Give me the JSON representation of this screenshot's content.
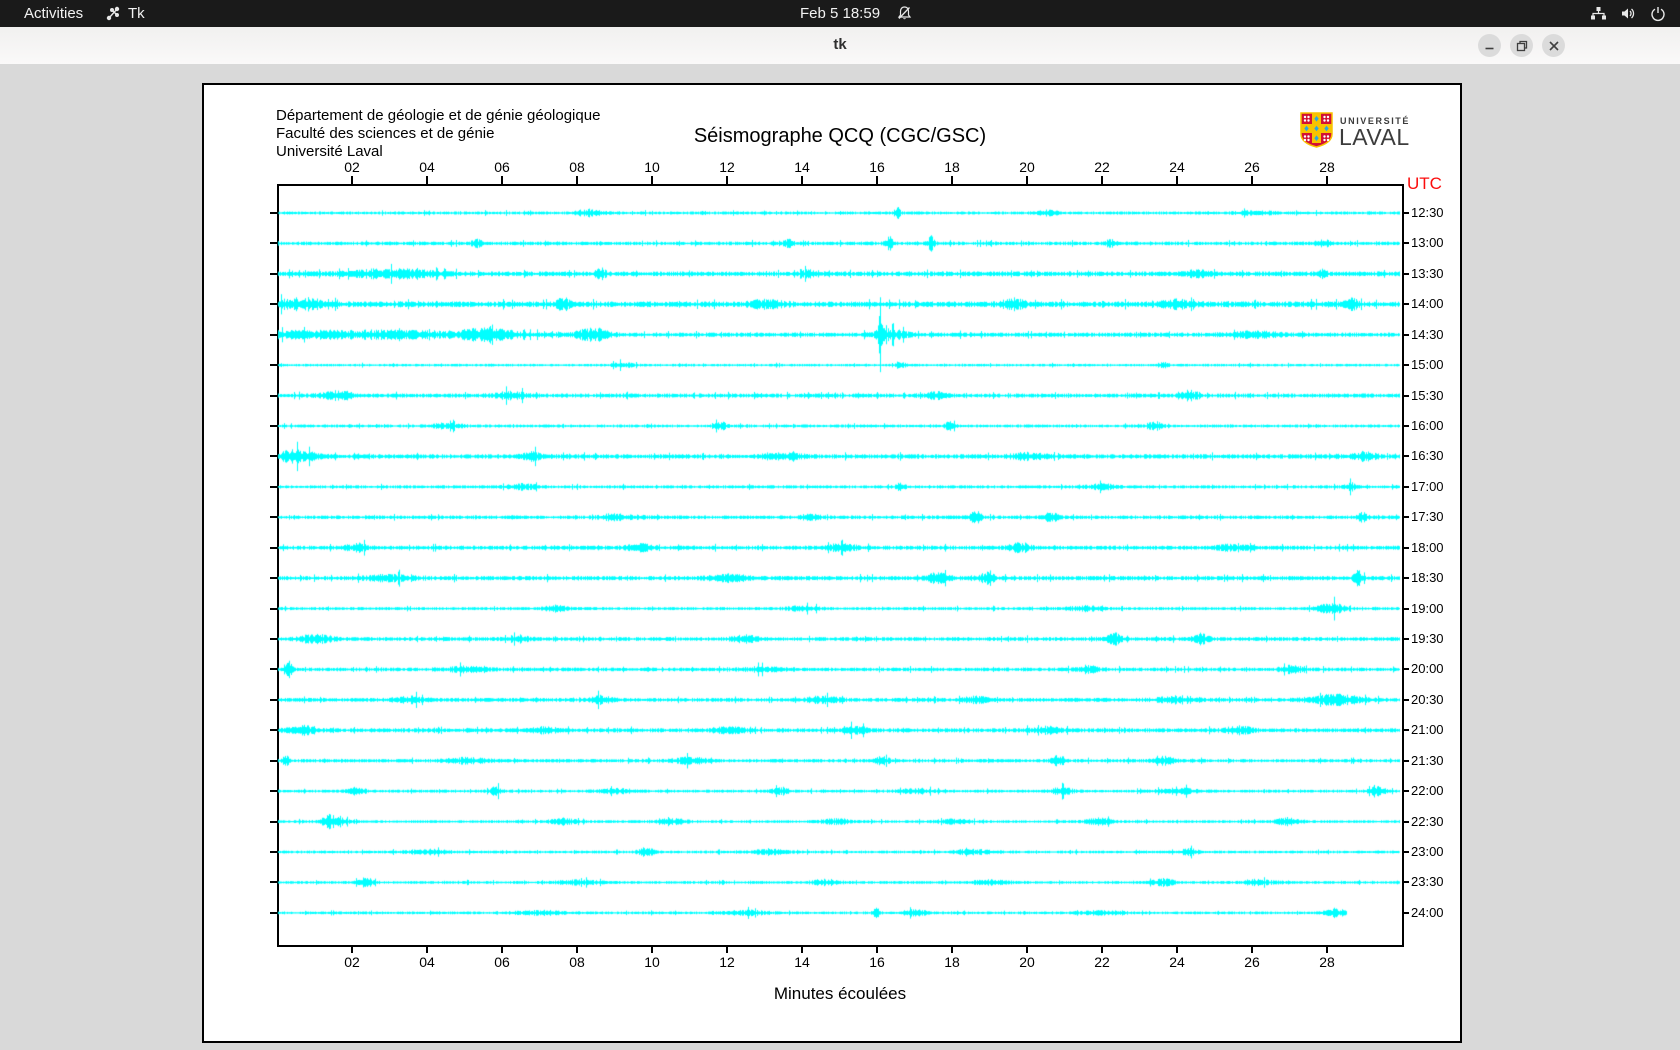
{
  "topbar": {
    "activities_label": "Activities",
    "app_name": "Tk",
    "clock": "Feb 5 18:59",
    "icons": {
      "app": "tk-icon",
      "notifications": "bell-muted-icon",
      "network": "network-icon",
      "volume": "volume-icon",
      "power": "power-icon"
    }
  },
  "titlebar": {
    "title": "tk",
    "icons": {
      "minimize": "minimize-icon",
      "maximize": "restore-icon",
      "close": "close-icon"
    }
  },
  "seismograph": {
    "header_lines": [
      "Département de géologie et de génie géologique",
      "Faculté des sciences et de génie",
      "Université Laval"
    ],
    "title": "Séismographe QCQ (CGC/GSC)",
    "logo": {
      "line1": "UNIVERSITÉ",
      "line2": "LAVAL",
      "crest_red": "#d21034",
      "crest_gold": "#f8c300",
      "crest_blue": "#2aa8e0"
    },
    "utc_label": "UTC",
    "xlabel": "Minutes écoulées",
    "colors": {
      "trace": "#00ffff",
      "utc_label": "#fb0d0d",
      "axis": "#000000",
      "background": "#ffffff"
    },
    "chart_data": {
      "type": "seismogram-helicorder",
      "x_unit": "minutes",
      "x_range": [
        0,
        30
      ],
      "x_tick_labels": [
        "02",
        "04",
        "06",
        "08",
        "10",
        "12",
        "14",
        "16",
        "18",
        "20",
        "22",
        "24",
        "26",
        "28"
      ],
      "trace_color": "#00ffff",
      "row_spacing_px": 30.43,
      "traces": [
        {
          "label": "12:30",
          "base": 1.4,
          "events": [
            [
              8.3,
              3,
              0.25
            ],
            [
              16.5,
              5,
              0.06
            ],
            [
              20.5,
              2,
              0.2
            ],
            [
              26,
              1.5,
              0.4
            ]
          ]
        },
        {
          "label": "13:00",
          "base": 1.7,
          "events": [
            [
              5.3,
              3,
              0.1
            ],
            [
              13.6,
              4,
              0.08
            ],
            [
              16.3,
              5,
              0.07
            ],
            [
              17.4,
              6,
              0.06
            ],
            [
              22.2,
              3,
              0.1
            ],
            [
              27.9,
              3,
              0.1
            ]
          ]
        },
        {
          "label": "13:30",
          "base": 2.2,
          "events": [
            [
              3,
              3.5,
              0.8
            ],
            [
              8.6,
              4,
              0.1
            ],
            [
              14.2,
              3,
              0.15
            ],
            [
              24.5,
              3,
              0.2
            ],
            [
              27.8,
              4,
              0.1
            ]
          ]
        },
        {
          "label": "14:00",
          "base": 2.6,
          "events": [
            [
              0.6,
              4,
              0.5
            ],
            [
              7.6,
              5,
              0.12
            ],
            [
              13,
              3,
              0.3
            ],
            [
              19.6,
              4,
              0.2
            ],
            [
              24,
              3,
              0.3
            ],
            [
              28.6,
              5,
              0.12
            ]
          ]
        },
        {
          "label": "14:30",
          "base": 2.0,
          "events": [
            [
              2,
              3,
              2.5
            ],
            [
              5.6,
              4,
              0.5
            ],
            [
              8.4,
              5,
              0.3
            ],
            [
              16.05,
              16,
              0.05
            ],
            [
              16.3,
              4,
              0.3
            ],
            [
              26,
              2,
              0.5
            ]
          ]
        },
        {
          "label": "15:00",
          "base": 1.2,
          "events": [
            [
              9.2,
              2,
              0.2
            ],
            [
              16.6,
              3,
              0.08
            ],
            [
              23.6,
              2.5,
              0.1
            ]
          ]
        },
        {
          "label": "15:30",
          "base": 1.9,
          "events": [
            [
              1.6,
              3.5,
              0.3
            ],
            [
              6.2,
              3,
              0.3
            ],
            [
              17.5,
              2.5,
              0.2
            ],
            [
              24.3,
              4,
              0.15
            ]
          ]
        },
        {
          "label": "16:00",
          "base": 1.4,
          "events": [
            [
              4.5,
              2,
              0.3
            ],
            [
              11.8,
              3,
              0.12
            ],
            [
              17.9,
              3,
              0.1
            ],
            [
              23.4,
              3.5,
              0.12
            ]
          ]
        },
        {
          "label": "16:30",
          "base": 2.1,
          "events": [
            [
              0.5,
              5,
              0.35
            ],
            [
              6.8,
              3.5,
              0.2
            ],
            [
              13.5,
              2.5,
              0.3
            ],
            [
              20,
              2.5,
              0.3
            ],
            [
              29,
              3.5,
              0.2
            ]
          ]
        },
        {
          "label": "17:00",
          "base": 1.5,
          "events": [
            [
              6.5,
              2,
              0.3
            ],
            [
              16.6,
              3.5,
              0.08
            ],
            [
              22,
              2,
              0.3
            ],
            [
              28.6,
              3,
              0.1
            ]
          ]
        },
        {
          "label": "17:30",
          "base": 1.7,
          "events": [
            [
              9,
              2.5,
              0.3
            ],
            [
              14.2,
              3,
              0.15
            ],
            [
              18.6,
              5,
              0.1
            ],
            [
              20.6,
              4,
              0.12
            ],
            [
              28.9,
              3.5,
              0.1
            ]
          ]
        },
        {
          "label": "18:00",
          "base": 1.9,
          "events": [
            [
              2.1,
              3,
              0.2
            ],
            [
              9.6,
              3,
              0.25
            ],
            [
              15,
              2.5,
              0.3
            ],
            [
              19.8,
              3.5,
              0.2
            ],
            [
              25.5,
              2.5,
              0.3
            ]
          ]
        },
        {
          "label": "18:30",
          "base": 2.0,
          "events": [
            [
              3,
              2.5,
              0.4
            ],
            [
              12,
              2.5,
              0.4
            ],
            [
              17.6,
              4,
              0.2
            ],
            [
              18.9,
              4,
              0.15
            ],
            [
              28.8,
              7,
              0.08
            ]
          ]
        },
        {
          "label": "19:00",
          "base": 1.4,
          "events": [
            [
              7.4,
              2.5,
              0.2
            ],
            [
              14,
              2,
              0.3
            ],
            [
              21.5,
              2,
              0.3
            ],
            [
              28.1,
              4.5,
              0.25
            ]
          ]
        },
        {
          "label": "19:30",
          "base": 1.8,
          "events": [
            [
              1,
              3.5,
              0.3
            ],
            [
              6.4,
              3,
              0.2
            ],
            [
              12.5,
              2.5,
              0.3
            ],
            [
              22.3,
              5,
              0.12
            ],
            [
              24.6,
              4,
              0.15
            ]
          ]
        },
        {
          "label": "20:00",
          "base": 1.7,
          "events": [
            [
              0.25,
              9,
              0.07
            ],
            [
              5,
              2,
              0.4
            ],
            [
              13,
              2,
              0.4
            ],
            [
              21.6,
              3,
              0.2
            ],
            [
              27,
              3,
              0.2
            ]
          ]
        },
        {
          "label": "20:30",
          "base": 1.8,
          "events": [
            [
              3.5,
              2.5,
              0.3
            ],
            [
              8.6,
              3,
              0.2
            ],
            [
              14.5,
              2.5,
              0.3
            ],
            [
              18.6,
              3,
              0.2
            ],
            [
              24,
              2.5,
              0.4
            ],
            [
              28.2,
              4,
              0.5
            ]
          ]
        },
        {
          "label": "21:00",
          "base": 1.9,
          "events": [
            [
              0.6,
              3.5,
              0.25
            ],
            [
              7.1,
              3,
              0.2
            ],
            [
              12,
              2.5,
              0.3
            ],
            [
              15.4,
              3,
              0.2
            ],
            [
              20.5,
              2.5,
              0.3
            ],
            [
              25.6,
              3,
              0.25
            ]
          ]
        },
        {
          "label": "21:30",
          "base": 1.6,
          "events": [
            [
              0.2,
              6,
              0.06
            ],
            [
              5,
              2,
              0.4
            ],
            [
              11,
              2.5,
              0.3
            ],
            [
              16.1,
              3,
              0.15
            ],
            [
              20.8,
              4.5,
              0.12
            ],
            [
              23.6,
              3,
              0.2
            ]
          ]
        },
        {
          "label": "22:00",
          "base": 1.4,
          "events": [
            [
              2.1,
              3,
              0.15
            ],
            [
              5.8,
              3.5,
              0.12
            ],
            [
              9,
              2,
              0.3
            ],
            [
              13.4,
              3,
              0.15
            ],
            [
              17,
              2,
              0.3
            ],
            [
              20.9,
              3,
              0.2
            ],
            [
              24,
              2,
              0.4
            ],
            [
              29.3,
              3.5,
              0.15
            ]
          ]
        },
        {
          "label": "22:30",
          "base": 1.3,
          "events": [
            [
              1.45,
              6.5,
              0.22
            ],
            [
              7.6,
              2.5,
              0.25
            ],
            [
              10.5,
              2,
              0.3
            ],
            [
              14.9,
              2,
              0.3
            ],
            [
              18,
              2,
              0.3
            ],
            [
              21.9,
              2.5,
              0.25
            ],
            [
              26.9,
              3,
              0.2
            ]
          ]
        },
        {
          "label": "23:00",
          "base": 1.3,
          "events": [
            [
              4,
              1.8,
              0.4
            ],
            [
              9.8,
              3.5,
              0.15
            ],
            [
              13.1,
              2,
              0.3
            ],
            [
              18.5,
              1.8,
              0.4
            ],
            [
              24.3,
              3.5,
              0.15
            ]
          ]
        },
        {
          "label": "23:30",
          "base": 1.3,
          "events": [
            [
              2.3,
              3.5,
              0.2
            ],
            [
              8,
              1.8,
              0.4
            ],
            [
              14.6,
              2.2,
              0.3
            ],
            [
              19,
              1.8,
              0.4
            ],
            [
              23.6,
              3,
              0.2
            ],
            [
              26.1,
              2.2,
              0.3
            ]
          ]
        },
        {
          "label": "24:00",
          "base": 1.3,
          "end": 28.5,
          "events": [
            [
              7,
              1.6,
              0.5
            ],
            [
              12.5,
              1.8,
              0.4
            ],
            [
              15.95,
              5.5,
              0.06
            ],
            [
              17,
              2.5,
              0.2
            ],
            [
              22,
              1.8,
              0.4
            ],
            [
              28.2,
              3,
              0.2
            ]
          ]
        }
      ]
    }
  }
}
